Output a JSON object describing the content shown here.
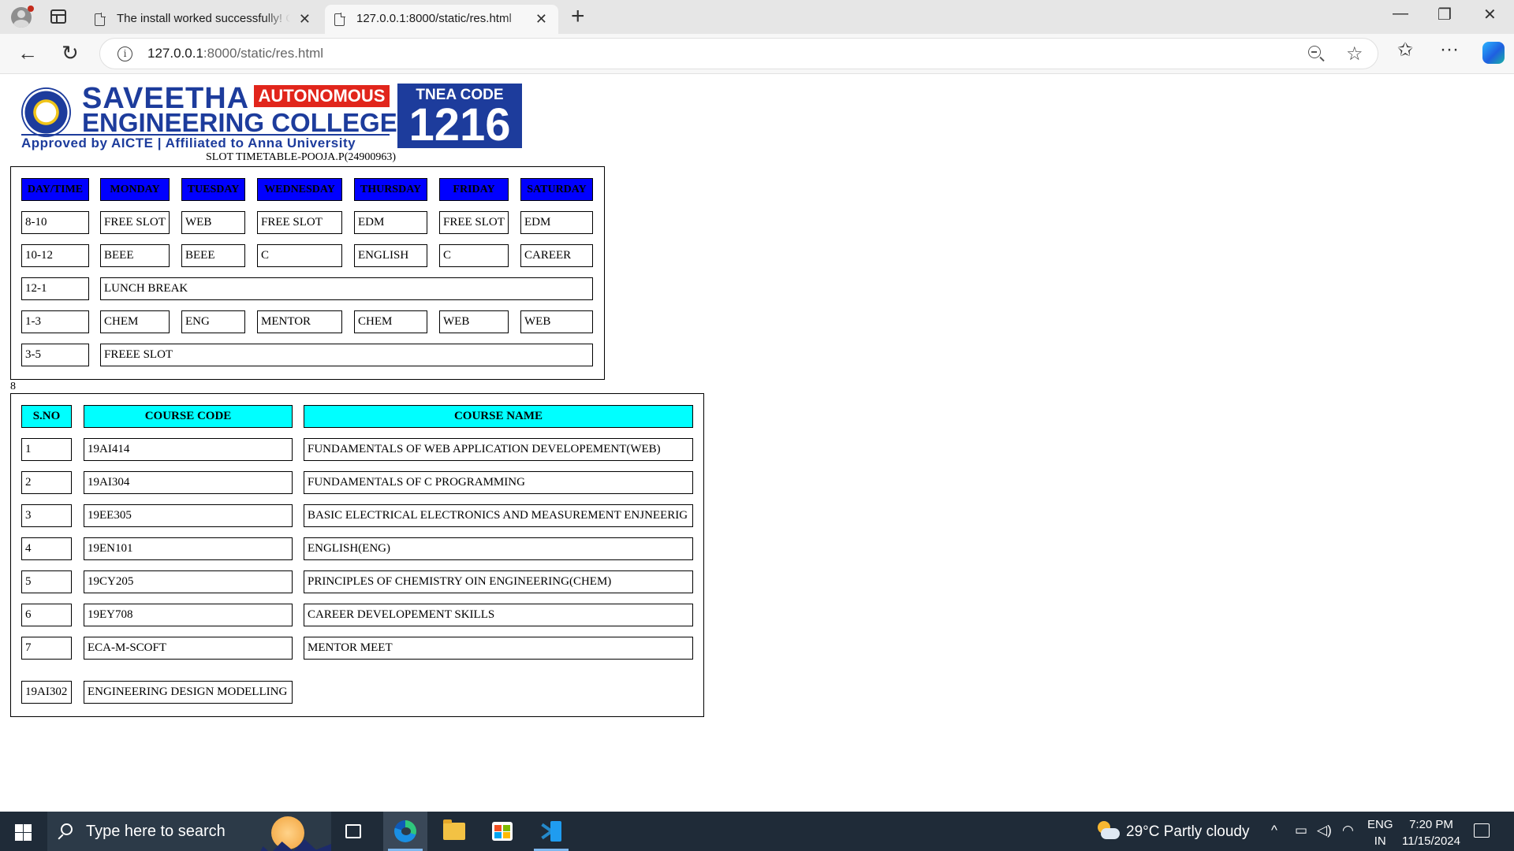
{
  "browser": {
    "tabs": [
      {
        "title": "The install worked successfully! Co",
        "close": "✕"
      },
      {
        "title": "127.0.0.1:8000/static/res.html",
        "close": "✕"
      }
    ],
    "new_tab": "+",
    "url_host": "127.0.0.1",
    "url_path": ":8000/static/res.html",
    "window": {
      "minimize": "—",
      "restore": "❐",
      "close": "✕"
    },
    "nav": {
      "back": "←",
      "reload": "↻",
      "star": "☆",
      "favorites": "✩",
      "more": "···"
    }
  },
  "logo": {
    "name_line1": "SAVEETHA",
    "autonomous": "AUTONOMOUS",
    "name_line2": "ENGINEERING COLLEGE",
    "approved": "Approved by AICTE  |  Affiliated to Anna University",
    "tnea_label": "TNEA CODE",
    "tnea_code": "1216"
  },
  "timetable": {
    "title": "SLOT TIMETABLE-POOJA.P(24900963)",
    "headers": [
      "DAY/TIME",
      "MONDAY",
      "TUESDAY",
      "WEDNESDAY",
      "THURSDAY",
      "FRIDAY",
      "SATURDAY"
    ],
    "rows": [
      [
        "8-10",
        "FREE SLOT",
        "WEB",
        "FREE SLOT",
        "EDM",
        "FREE SLOT",
        "EDM"
      ],
      [
        "10-12",
        "BEEE",
        "BEEE",
        "C",
        "ENGLISH",
        "C",
        "CAREER"
      ],
      [
        "12-1",
        "LUNCH BREAK"
      ],
      [
        "1-3",
        "CHEM",
        "ENG",
        "MENTOR",
        "CHEM",
        "WEB",
        "WEB"
      ],
      [
        "3-5",
        "FREEE SLOT"
      ]
    ],
    "header_color": "#0000ff"
  },
  "stray_text": "8",
  "courses": {
    "headers": [
      "S.NO",
      "COURSE CODE",
      "COURSE NAME"
    ],
    "rows": [
      [
        "1",
        "19AI414",
        "FUNDAMENTALS OF WEB APPLICATION DEVELOPEMENT(WEB)"
      ],
      [
        "2",
        "19AI304",
        "FUNDAMENTALS OF C PROGRAMMING"
      ],
      [
        "3",
        "19EE305",
        "BASIC ELECTRICAL ELECTRONICS AND MEASUREMENT ENJNEERIG"
      ],
      [
        "4",
        "19EN101",
        "ENGLISH(ENG)"
      ],
      [
        "5",
        "19CY205",
        "PRINCIPLES OF CHEMISTRY OIN ENGINEERING(CHEM)"
      ],
      [
        "6",
        "19EY708",
        "CAREER DEVELOPEMENT SKILLS"
      ],
      [
        "7",
        "ECA-M-SCOFT",
        "MENTOR MEET"
      ],
      [
        "19AI302",
        "ENGINEERING DESIGN MODELLING"
      ]
    ],
    "header_color": "#00ffff"
  },
  "taskbar": {
    "search_placeholder": "Type here to search",
    "weather": "29°C  Partly cloudy",
    "lang_top": "ENG",
    "lang_bottom": "IN",
    "time": "7:20 PM",
    "date": "11/15/2024",
    "tray_chevron": "^"
  }
}
